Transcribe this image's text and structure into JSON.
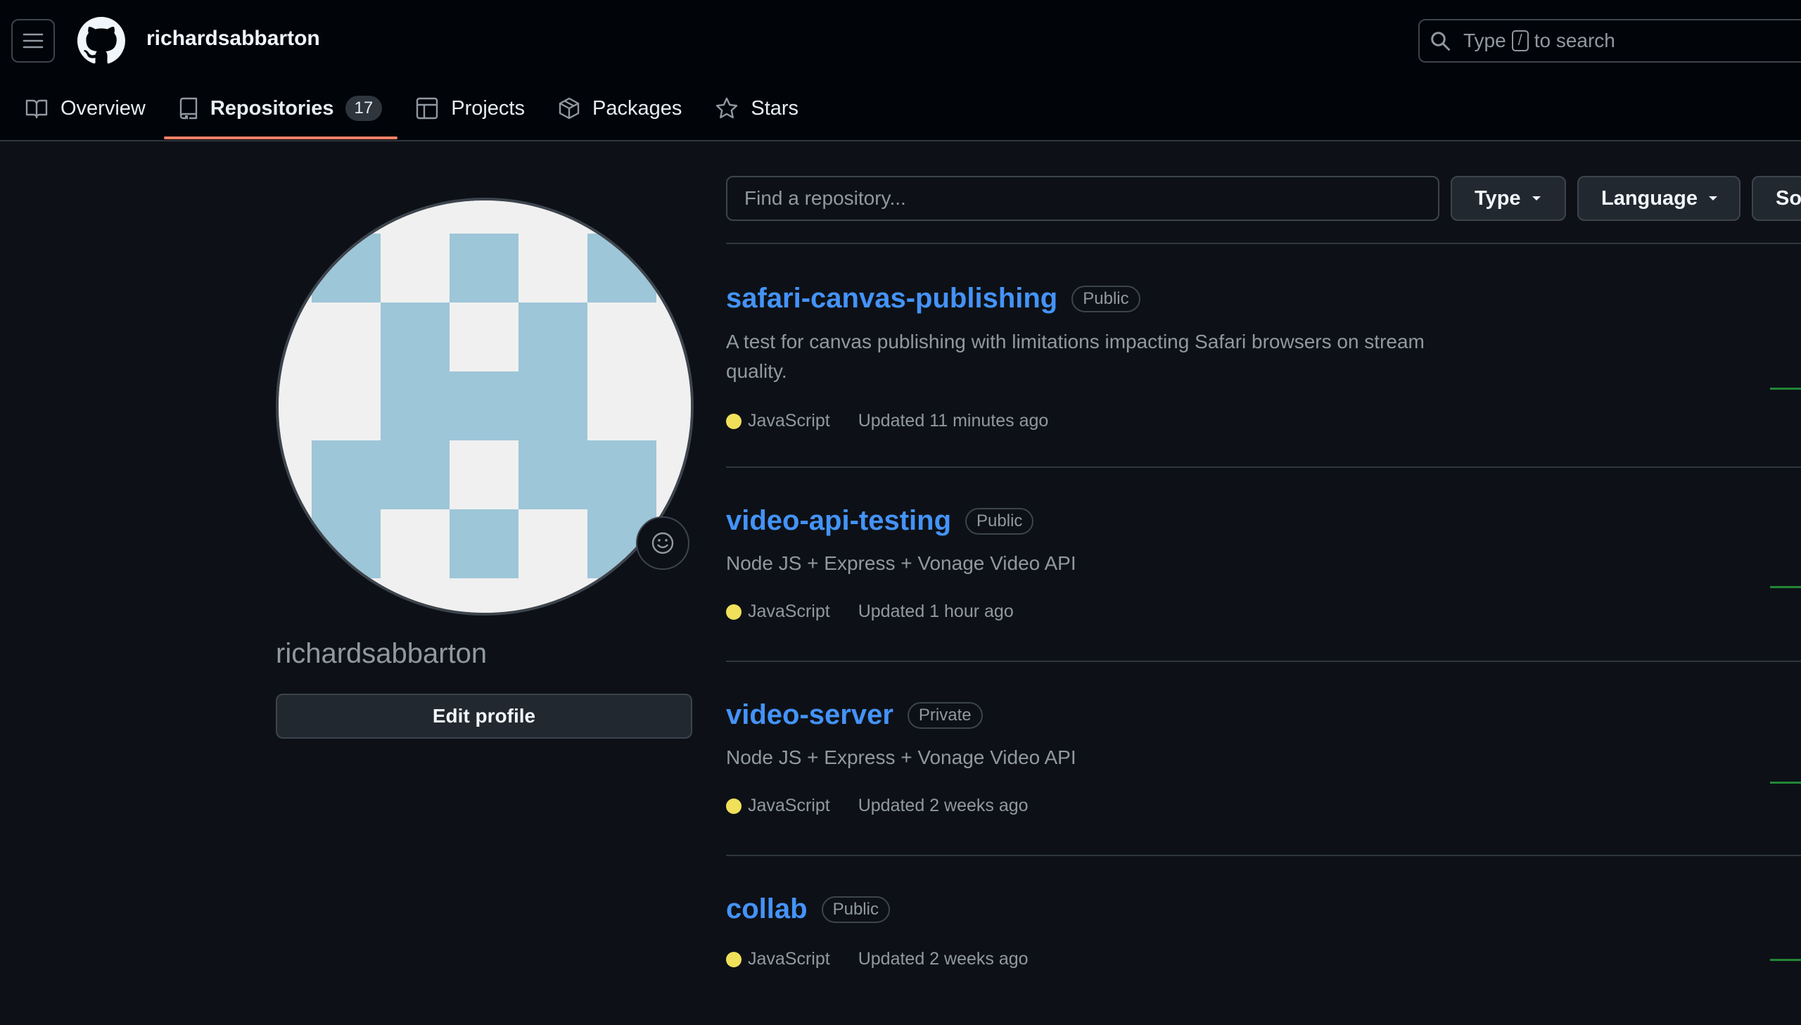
{
  "header": {
    "username": "richardsabbarton",
    "search": {
      "prefix": "Type",
      "key": "/",
      "suffix": "to search"
    }
  },
  "tabs": [
    {
      "label": "Overview"
    },
    {
      "label": "Repositories",
      "count": "17",
      "active": true
    },
    {
      "label": "Projects"
    },
    {
      "label": "Packages"
    },
    {
      "label": "Stars"
    }
  ],
  "profile": {
    "display_username": "richardsabbarton",
    "edit_label": "Edit profile"
  },
  "filters": {
    "find_placeholder": "Find a repository...",
    "type_label": "Type",
    "language_label": "Language",
    "sort_label": "Sort"
  },
  "repos": [
    {
      "name": "safari-canvas-publishing",
      "visibility": "Public",
      "description": "A test for canvas publishing with limitations impacting Safari browsers on stream quality.",
      "language": "JavaScript",
      "updated": "Updated 11 minutes ago"
    },
    {
      "name": "video-api-testing",
      "visibility": "Public",
      "description": "Node JS + Express + Vonage Video API",
      "language": "JavaScript",
      "updated": "Updated 1 hour ago"
    },
    {
      "name": "video-server",
      "visibility": "Private",
      "description": "Node JS + Express + Vonage Video API",
      "language": "JavaScript",
      "updated": "Updated 2 weeks ago"
    },
    {
      "name": "collab",
      "visibility": "Public",
      "description": "",
      "language": "JavaScript",
      "updated": "Updated 2 weeks ago"
    }
  ],
  "colors": {
    "accent_link": "#4493f8",
    "tab_underline": "#f78166",
    "javascript": "#f1e05a",
    "avatar_blue": "#9dc6d8"
  }
}
